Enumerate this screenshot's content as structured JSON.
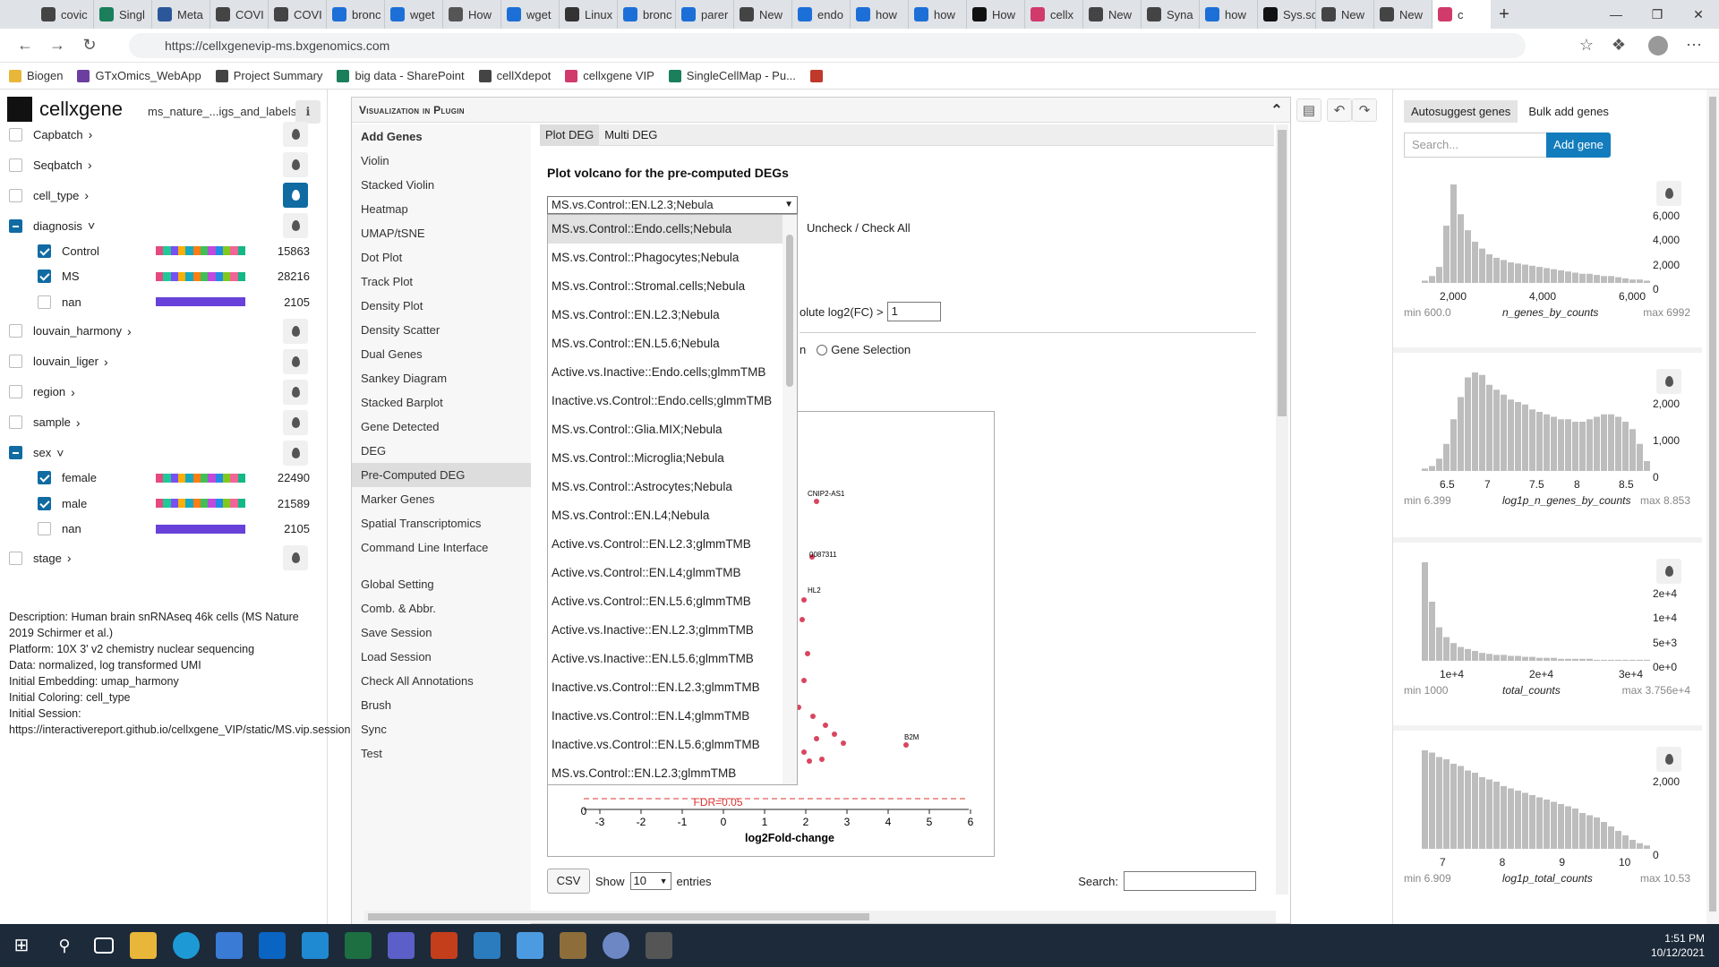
{
  "browser": {
    "tabs": [
      "covic",
      "Singl",
      "Meta",
      "COVI",
      "COVI",
      "bronc",
      "wget",
      "How",
      "wget",
      "Linux",
      "bronc",
      "parer",
      "New",
      "endo",
      "how",
      "how",
      "How",
      "cellx",
      "New",
      "Syna",
      "how",
      "Sys.sc",
      "New",
      "New",
      "c"
    ],
    "active_tab_index": 24,
    "url": "https://cellxgenevip-ms.bxgenomics.com",
    "bookmarks": [
      "Biogen",
      "GTxOmics_WebApp",
      "Project Summary",
      "big data - SharePoint",
      "cellXdepot",
      "cellxgene VIP",
      "SingleCellMap - Pu..."
    ]
  },
  "left": {
    "app_name": "cellxgene",
    "dataset": "ms_nature_...igs_and_labels",
    "categories": [
      {
        "label": "Capbatch",
        "state": "off"
      },
      {
        "label": "Seqbatch",
        "state": "off"
      },
      {
        "label": "cell_type",
        "state": "off",
        "active_color": true
      },
      {
        "label": "diagnosis",
        "state": "ind",
        "expanded": true,
        "values": [
          {
            "label": "Control",
            "count": "15863",
            "checked": true
          },
          {
            "label": "MS",
            "count": "28216",
            "checked": true
          },
          {
            "label": "nan",
            "count": "2105",
            "checked": false
          }
        ]
      },
      {
        "label": "louvain_harmony",
        "state": "off"
      },
      {
        "label": "louvain_liger",
        "state": "off"
      },
      {
        "label": "region",
        "state": "off"
      },
      {
        "label": "sample",
        "state": "off"
      },
      {
        "label": "sex",
        "state": "ind",
        "expanded": true,
        "values": [
          {
            "label": "female",
            "count": "22490",
            "checked": true
          },
          {
            "label": "male",
            "count": "21589",
            "checked": true
          },
          {
            "label": "nan",
            "count": "2105",
            "checked": false
          }
        ]
      },
      {
        "label": "stage",
        "state": "off"
      }
    ],
    "description": "Description: Human brain snRNAseq 46k cells (MS Nature 2019 Schirmer et al.)\nPlatform: 10X 3' v2 chemistry nuclear sequencing\nData: normalized, log transformed UMI\nInitial Embedding: umap_harmony\nInitial Coloring: cell_type\nInitial Session:\nhttps://interactivereport.github.io/cellxgene_VIP/static/MS.vip.session.txt"
  },
  "plugin": {
    "title": "Visualization in Plugin",
    "menu": [
      "Add Genes",
      "Violin",
      "Stacked Violin",
      "Heatmap",
      "UMAP/tSNE",
      "Dot Plot",
      "Track Plot",
      "Density Plot",
      "Density Scatter",
      "Dual Genes",
      "Sankey Diagram",
      "Stacked Barplot",
      "Gene Detected",
      "DEG",
      "Pre-Computed DEG",
      "Marker Genes",
      "Spatial Transcriptomics",
      "Command Line Interface"
    ],
    "menu2": [
      "Global Setting",
      "Comb. & Abbr.",
      "Save Session",
      "Load Session",
      "Check All Annotations",
      "Brush",
      "Sync",
      "Test"
    ],
    "selected_menu": "Pre-Computed DEG",
    "subtabs": [
      "Plot DEG",
      "Multi DEG"
    ],
    "heading": "Plot volcano for the pre-computed DEGs",
    "selected_option": "MS.vs.Control::EN.L2.3;Nebula",
    "options": [
      "MS.vs.Control::Endo.cells;Nebula",
      "MS.vs.Control::Phagocytes;Nebula",
      "MS.vs.Control::Stromal.cells;Nebula",
      "MS.vs.Control::EN.L2.3;Nebula",
      "MS.vs.Control::EN.L5.6;Nebula",
      "Active.vs.Inactive::Endo.cells;glmmTMB",
      "Inactive.vs.Control::Endo.cells;glmmTMB",
      "MS.vs.Control::Glia.MIX;Nebula",
      "MS.vs.Control::Microglia;Nebula",
      "MS.vs.Control::Astrocytes;Nebula",
      "MS.vs.Control::EN.L4;Nebula",
      "Active.vs.Control::EN.L2.3;glmmTMB",
      "Active.vs.Control::EN.L4;glmmTMB",
      "Active.vs.Control::EN.L5.6;glmmTMB",
      "Active.vs.Inactive::EN.L2.3;glmmTMB",
      "Active.vs.Inactive::EN.L5.6;glmmTMB",
      "Inactive.vs.Control::EN.L2.3;glmmTMB",
      "Inactive.vs.Control::EN.L4;glmmTMB",
      "Inactive.vs.Control::EN.L5.6;glmmTMB",
      "MS.vs.Control::EN.L2.3;glmmTMB"
    ],
    "uncheck_label": "Uncheck / Check All",
    "log2fc_label": "olute log2(FC) >",
    "log2fc_value": "1",
    "gene_selection_label": "Gene Selection",
    "n_label": "n",
    "volcano": {
      "x_ticks": [
        "-3",
        "-2",
        "-1",
        "0",
        "1",
        "2",
        "3",
        "4",
        "5",
        "6"
      ],
      "y_tick": "0",
      "fdr_label": "FDR=0.05",
      "xlabel": "log2Fold-change",
      "gene_labels": [
        "CNIP2-AS1",
        "0087311",
        "HL2",
        "B2M"
      ]
    },
    "csv_label": "CSV",
    "show_label": "Show",
    "show_value": "10",
    "entries_label": "entries",
    "search_label": "Search:"
  },
  "right": {
    "tabs": [
      "Autosuggest genes",
      "Bulk add genes"
    ],
    "search_placeholder": "Search...",
    "add_gene_label": "Add gene",
    "histograms": [
      {
        "name": "n_genes_by_counts",
        "min": "min 600.0",
        "max": "max 6992",
        "yticks": [
          "6,000",
          "4,000",
          "2,000",
          "0"
        ],
        "xticks": [
          "2,000",
          "4,000",
          "6,000"
        ],
        "bins": [
          2,
          6,
          14,
          50,
          86,
          60,
          46,
          36,
          30,
          25,
          22,
          20,
          18,
          17,
          16,
          15,
          14,
          13,
          12,
          11,
          10,
          9,
          8,
          8,
          7,
          6,
          6,
          5,
          4,
          3,
          3,
          2
        ]
      },
      {
        "name": "log1p_n_genes_by_counts",
        "min": "min 6.399",
        "max": "max 8.853",
        "yticks": [
          "2,000",
          "1,000",
          "0"
        ],
        "xticks": [
          "6.5",
          "7",
          "7.5",
          "8",
          "8.5"
        ],
        "bins": [
          2,
          4,
          10,
          22,
          42,
          60,
          76,
          80,
          78,
          70,
          66,
          62,
          58,
          56,
          54,
          50,
          48,
          46,
          44,
          42,
          42,
          40,
          40,
          42,
          44,
          46,
          46,
          44,
          40,
          34,
          22,
          8
        ]
      },
      {
        "name": "total_counts",
        "min": "min 1000",
        "max": "max 3.756e+4",
        "yticks": [
          "2e+4",
          "1e+4",
          "5e+3",
          "0e+0"
        ],
        "xticks": [
          "1e+4",
          "2e+4",
          "3e+4"
        ],
        "bins": [
          100,
          60,
          34,
          24,
          18,
          14,
          12,
          10,
          8,
          7,
          6,
          6,
          5,
          5,
          4,
          4,
          3,
          3,
          3,
          2,
          2,
          2,
          2,
          2,
          1,
          1,
          1,
          1,
          1,
          1,
          1,
          1
        ]
      },
      {
        "name": "log1p_total_counts",
        "min": "min 6.909",
        "max": "max 10.53",
        "yticks": [
          "2,000",
          "0"
        ],
        "xticks": [
          "7",
          "8",
          "9",
          "10"
        ],
        "bins": [
          88,
          86,
          82,
          80,
          76,
          74,
          70,
          68,
          64,
          62,
          60,
          56,
          54,
          52,
          50,
          48,
          46,
          44,
          42,
          40,
          38,
          36,
          32,
          30,
          28,
          24,
          20,
          16,
          12,
          8,
          5,
          3
        ]
      }
    ]
  },
  "taskbar": {
    "time": "1:51 PM",
    "date": "10/12/2021"
  }
}
